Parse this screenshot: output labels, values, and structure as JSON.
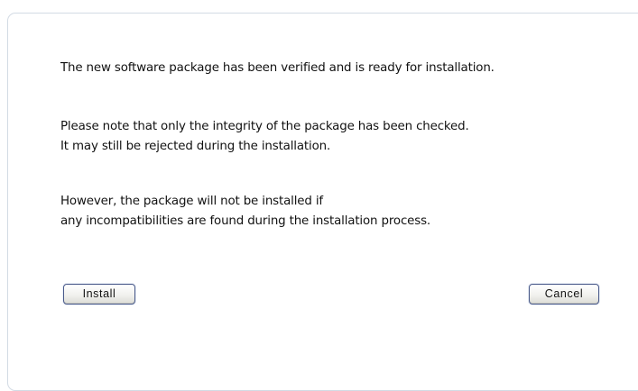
{
  "dialog": {
    "paragraphs": [
      [
        "The new software package has been verified and is ready for installation."
      ],
      [
        "Please note that only the integrity of the package has been checked.",
        "It may still be rejected during the installation."
      ],
      [
        "However, the package will not be installed if",
        "any incompatibilities are found during the installation process."
      ]
    ],
    "install_label": "Install",
    "cancel_label": "Cancel"
  }
}
